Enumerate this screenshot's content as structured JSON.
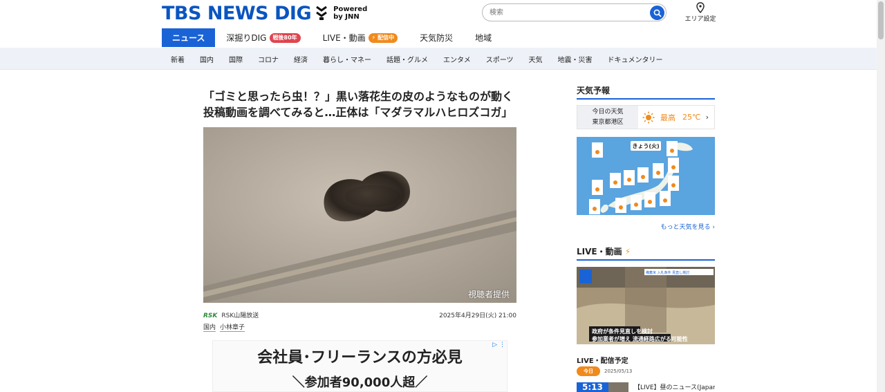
{
  "header": {
    "logo_text": "TBS NEWS DIG",
    "powered_line1": "Powered",
    "powered_line2": "by JNN",
    "search_placeholder": "検索",
    "area_label": "エリア設定"
  },
  "main_nav": [
    {
      "label": "ニュース",
      "active": true
    },
    {
      "label": "深掘りDIG",
      "badge": "戦後80年",
      "badge_color": "red"
    },
    {
      "label": "LIVE・動画",
      "badge": "配信中",
      "badge_color": "orange"
    },
    {
      "label": "天気防災"
    },
    {
      "label": "地域"
    }
  ],
  "sub_nav": [
    "新着",
    "国内",
    "国際",
    "コロナ",
    "経済",
    "暮らし・マネー",
    "話題・グルメ",
    "エンタメ",
    "スポーツ",
    "天気",
    "地震・災害",
    "ドキュメンタリー"
  ],
  "article": {
    "title_line1": "「ゴミと思ったら虫！？」黒い落花生の皮のようなものが動く",
    "title_line2": "投稿動画を調べてみると…正体は「マダラマルハヒロズコガ」",
    "photo_credit": "視聴者提供",
    "source_logo": "RSK",
    "source_name": "RSK山陽放送",
    "date": "2025年4月29日(火) 21:00",
    "tags": [
      "国内",
      "小林章子"
    ]
  },
  "ad": {
    "headline": "会社員･フリーランスの方必見",
    "subline": "＼参加者90,000人超／"
  },
  "sidebar": {
    "weather_heading": "天気予報",
    "weather_today": "今日の天気",
    "weather_place": "東京都港区",
    "weather_high_label": "最高",
    "weather_high_value": "25℃",
    "map_label": "きょう(火)",
    "more_weather": "もっと天気を見る",
    "live_heading": "LIVE・動画",
    "live_caption1": "政府が条件見直しを検討",
    "live_caption2": "参加業者が増え 流通経路広がる可能性",
    "live_banner": "備蓄米 入札条件 見直し検討",
    "schedule_heading": "LIVE・配信予定",
    "today_label": "今日",
    "today_date": "2025/05/13",
    "schedule_time": "5:13",
    "schedule_title": "【LIVE】昼のニュース(Japan"
  },
  "colors": {
    "brand_blue": "#1a63d6",
    "badge_red": "#e0444f",
    "badge_orange": "#f08a1c"
  }
}
